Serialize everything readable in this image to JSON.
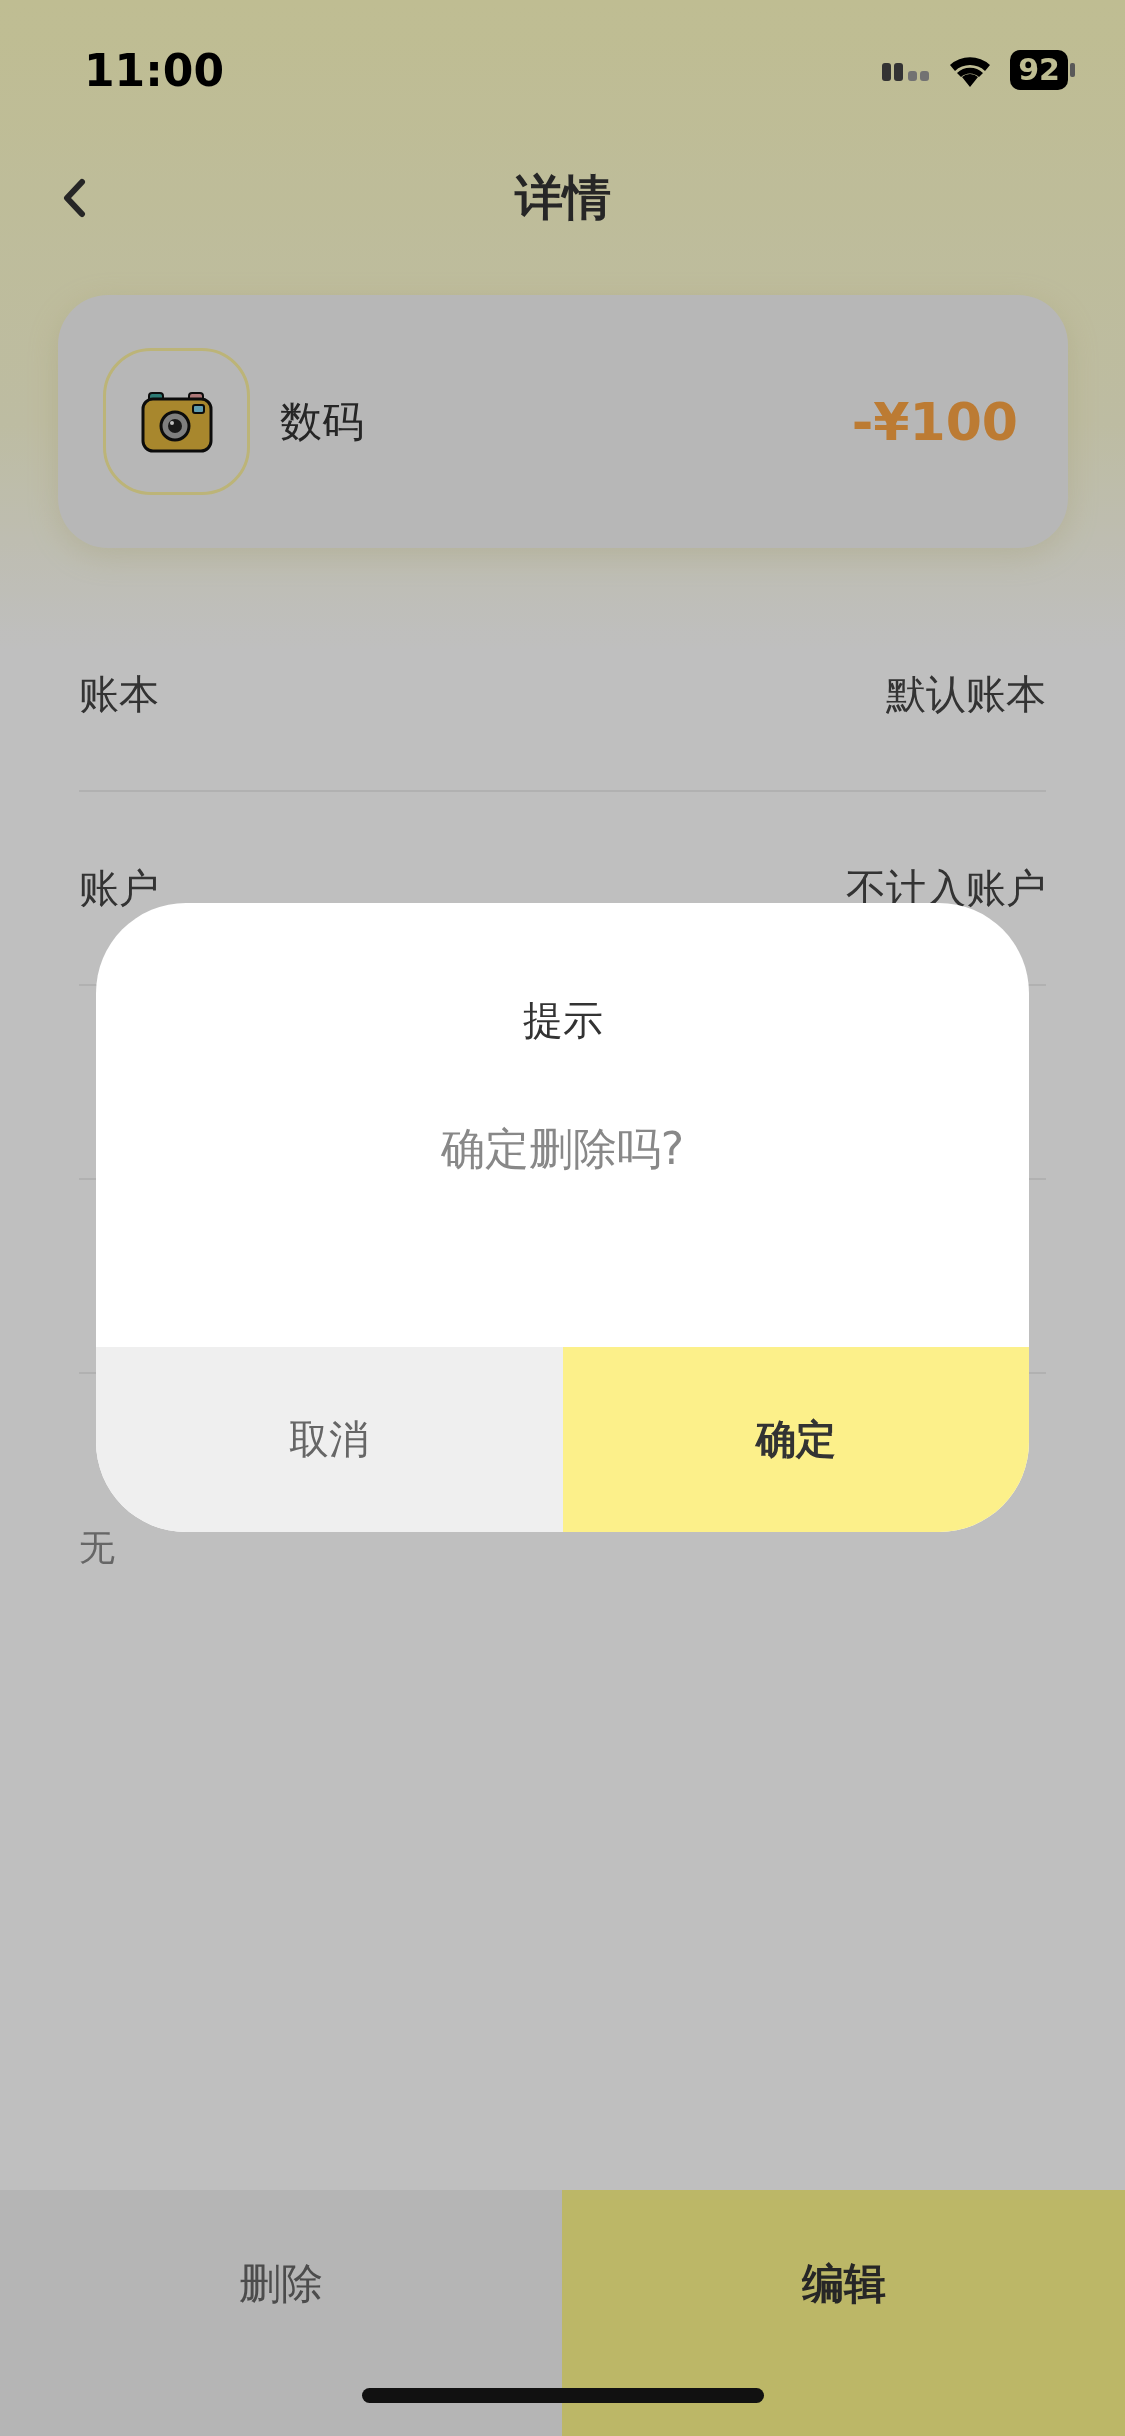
{
  "status_bar": {
    "time": "11:00",
    "battery": "92"
  },
  "header": {
    "title": "详情"
  },
  "summary": {
    "category": "数码",
    "amount": "-¥100"
  },
  "rows": [
    {
      "label": "账本",
      "value": "默认账本"
    },
    {
      "label": "账户",
      "value": "不计入账户"
    }
  ],
  "note": {
    "value": "无"
  },
  "dialog": {
    "title": "提示",
    "message": "确定删除吗?",
    "buttons": [
      {
        "label": "取消",
        "kind": "cancel"
      },
      {
        "label": "确定",
        "kind": "confirm"
      }
    ]
  },
  "bottom_bar": [
    {
      "label": "删除",
      "kind": "delete"
    },
    {
      "label": "编辑",
      "kind": "edit"
    }
  ]
}
